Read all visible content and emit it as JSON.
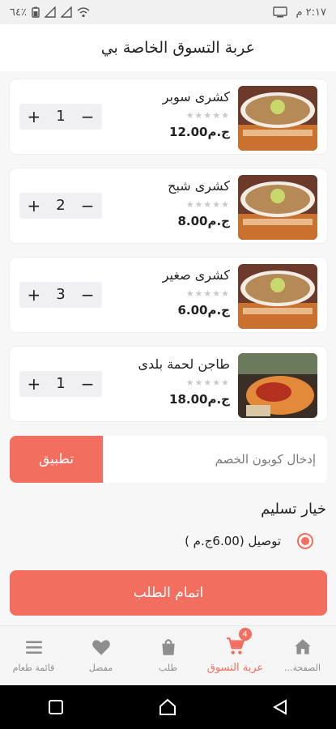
{
  "status_bar": {
    "time": "٢:١٧ م",
    "battery": "٦٤٪"
  },
  "header": {
    "title": "عربة التسوق الخاصة بي"
  },
  "cart_items": [
    {
      "name": "كشرى سوبر",
      "price": "12.00ج.م",
      "qty": "1",
      "stars": "★★★★★"
    },
    {
      "name": "كشرى شبح",
      "price": "8.00ج.م",
      "qty": "2",
      "stars": "★★★★★"
    },
    {
      "name": "كشرى صغير",
      "price": "6.00ج.م",
      "qty": "3",
      "stars": "★★★★★"
    },
    {
      "name": "طاجن لحمة بلدى",
      "price": "18.00ج.م",
      "qty": "1",
      "stars": "★★★★★"
    }
  ],
  "stepper": {
    "minus": "−",
    "plus": "+"
  },
  "coupon": {
    "placeholder": "إدخال كوبون الخصم",
    "apply_label": "تطبيق"
  },
  "delivery": {
    "title": "خيار تسليم",
    "option_label": "توصيل (6.00ج.م )"
  },
  "checkout_label": "اتمام الطلب",
  "bottom_nav": {
    "home": "الصفحة...",
    "cart": "عربة التسوق",
    "cart_badge": "4",
    "orders": "طلب",
    "favorites": "مفضل",
    "menu": "قائمة طعام"
  },
  "colors": {
    "accent": "#f36e5f"
  }
}
